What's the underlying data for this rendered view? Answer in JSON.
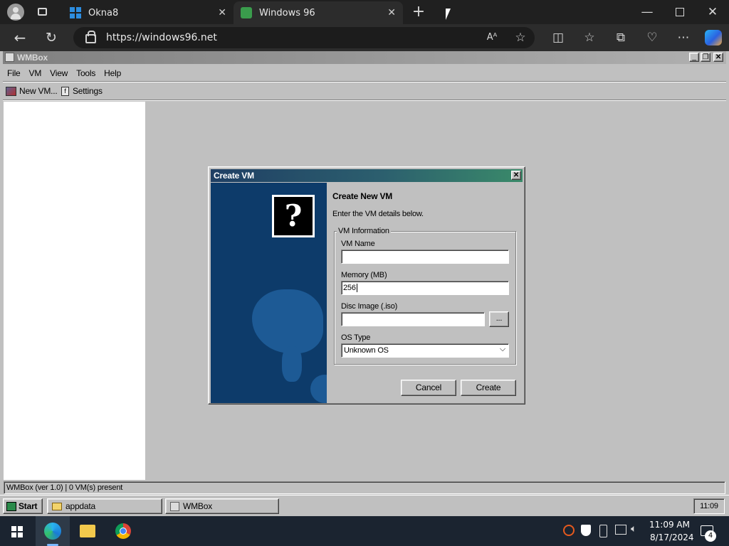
{
  "browser": {
    "tabs": [
      {
        "title": "Okna8"
      },
      {
        "title": "Windows 96"
      }
    ],
    "url": "https://windows96.net"
  },
  "app": {
    "title": "WMBox",
    "menu": [
      "File",
      "VM",
      "View",
      "Tools",
      "Help"
    ],
    "toolbar": {
      "new_vm": "New VM...",
      "settings": "Settings"
    },
    "status": "WMBox (ver 1.0) | 0 VM(s) present"
  },
  "dialog": {
    "title": "Create VM",
    "heading": "Create New VM",
    "subtitle": "Enter the VM details below.",
    "group_label": "VM Information",
    "fields": {
      "vm_name": {
        "label": "VM Name",
        "value": ""
      },
      "memory": {
        "label": "Memory (MB)",
        "value": "256"
      },
      "disc_image": {
        "label": "Disc Image (.iso)",
        "value": "",
        "browse_label": "..."
      },
      "os_type": {
        "label": "OS Type",
        "value": "Unknown OS"
      }
    },
    "cancel_label": "Cancel",
    "create_label": "Create"
  },
  "w96_taskbar": {
    "start_label": "Start",
    "items": [
      "appdata",
      "WMBox"
    ],
    "clock": "11:09"
  },
  "windows_taskbar": {
    "time": "11:09 AM",
    "date": "8/17/2024",
    "notification_count": "4"
  },
  "colors": {
    "title_active_start": "#1f3f64",
    "title_active_end": "#3a8a6a",
    "desktop": "#c0c0c0",
    "dialog_art": "#0d3b6a"
  }
}
